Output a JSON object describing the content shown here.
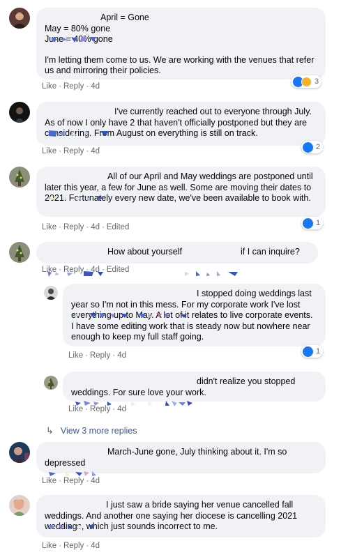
{
  "actions": {
    "like": "Like",
    "reply": "Reply",
    "sep": "·",
    "edited": "Edited"
  },
  "comments": [
    {
      "lines": [
        "April = Gone",
        "May = 80% gone",
        "June = 40% gone",
        "",
        "I'm letting them come to us. We are working with the venues that refer us and mirroring their policies."
      ],
      "time": "4d",
      "reactions": {
        "icons": [
          "like-icon",
          "wow-icon"
        ],
        "count": "3"
      }
    },
    {
      "lines": [
        "I've currently reached out to everyone through July. As of now I only have 2 that haven't officially postponed but they are considering. From August on everything is still on track."
      ],
      "time": "4d",
      "reactions": {
        "icons": [
          "like-icon"
        ],
        "count": "2"
      }
    },
    {
      "lines": [
        "All of our April and May weddings are postponed until later this year, a few for June as well. Some are moving their dates to 2021. Fortunately every new date, we've been available to book with."
      ],
      "time": "4d",
      "edited": true,
      "reactions": {
        "icons": [
          "like-icon"
        ],
        "count": "1"
      }
    },
    {
      "lines": [
        "How about yourself",
        "if I can inquire?"
      ],
      "time": "4d",
      "edited": true
    },
    {
      "lines": [
        "I stopped doing weddings last year so I'm not in this mess. For my corporate work I've lost everything up to May. A lot of it relates to live corporate events. I have some editing work that is steady now but nowhere near enough to keep my full staff going."
      ],
      "time": "4d",
      "reactions": {
        "icons": [
          "like-icon"
        ],
        "count": "1"
      }
    },
    {
      "lines": [
        "didn't realize you stopped weddings. For sure love your work."
      ],
      "time": "4d"
    },
    {
      "lines": [
        "March-June gone, July thinking about it. I'm so depressed"
      ],
      "time": "4d"
    },
    {
      "lines": [
        "I just saw a bride saying her venue cancelled fall weddings. And another one saying her diocese is cancelling 2021 weddings, which just sounds incorrect to me."
      ],
      "time": "4d"
    }
  ],
  "view_more": "View 3 more replies",
  "colors": {
    "bubble": "#f0f2f5",
    "meta": "#65676b",
    "like_blue": "#1877f2",
    "wow_yellow": "#f7b125",
    "link_blue": "#385898"
  }
}
